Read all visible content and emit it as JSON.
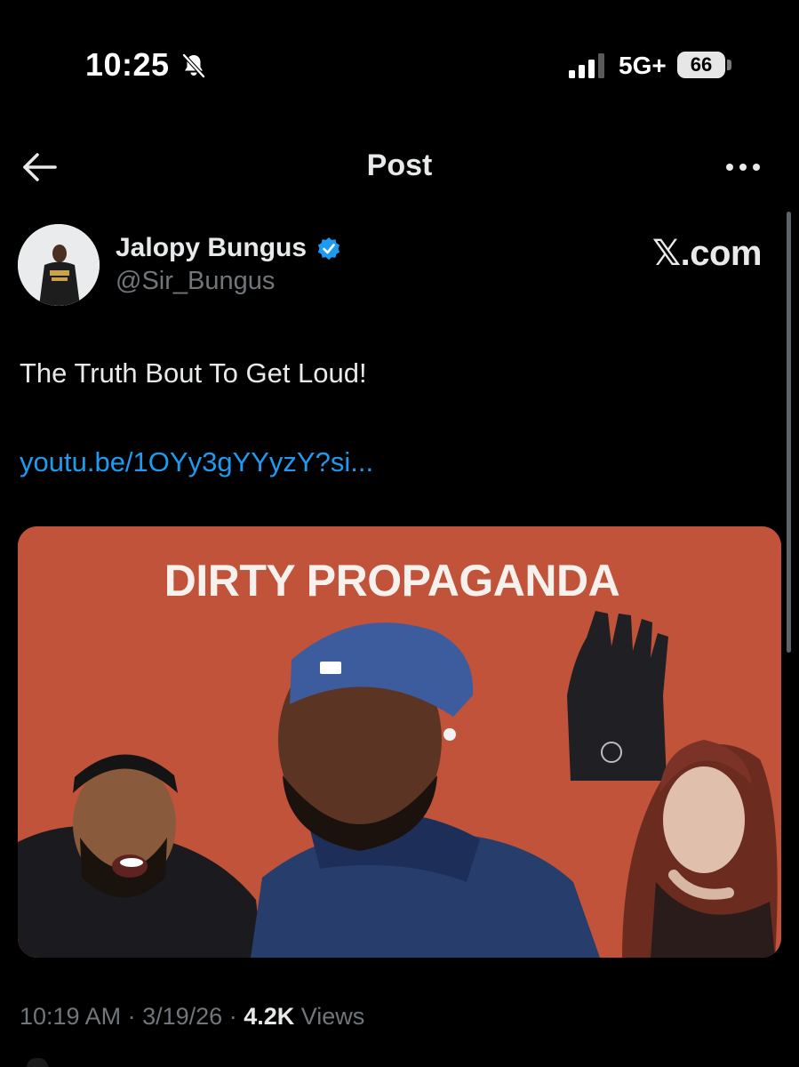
{
  "status_bar": {
    "time": "10:25",
    "network": "5G+",
    "battery": "66",
    "icons": [
      "bell-slash-icon",
      "cellular-signal-icon",
      "battery-icon"
    ]
  },
  "header": {
    "title": "Post",
    "back_icon": "arrow-left-icon",
    "more_icon": "more-horizontal-icon"
  },
  "post": {
    "author": {
      "name": "Jalopy Bungus",
      "handle": "@Sir_Bungus",
      "verified": true,
      "verified_icon": "verified-badge-icon"
    },
    "source_label": "𝕏.com",
    "text": "The Truth Bout To Get Loud!",
    "link": "youtu.be/1OYy3gYYyzY?si...",
    "media": {
      "headline": "DIRTY PROPAGANDA",
      "background_color": "#c0533a"
    },
    "meta": {
      "time": "10:19 AM",
      "date": "3/19/26",
      "views_count": "4.2K",
      "views_label": "Views"
    }
  },
  "colors": {
    "background": "#000000",
    "primary_text": "#e7e9ea",
    "secondary_text": "#71767b",
    "link": "#1d9bf0",
    "verified": "#1d9bf0"
  }
}
